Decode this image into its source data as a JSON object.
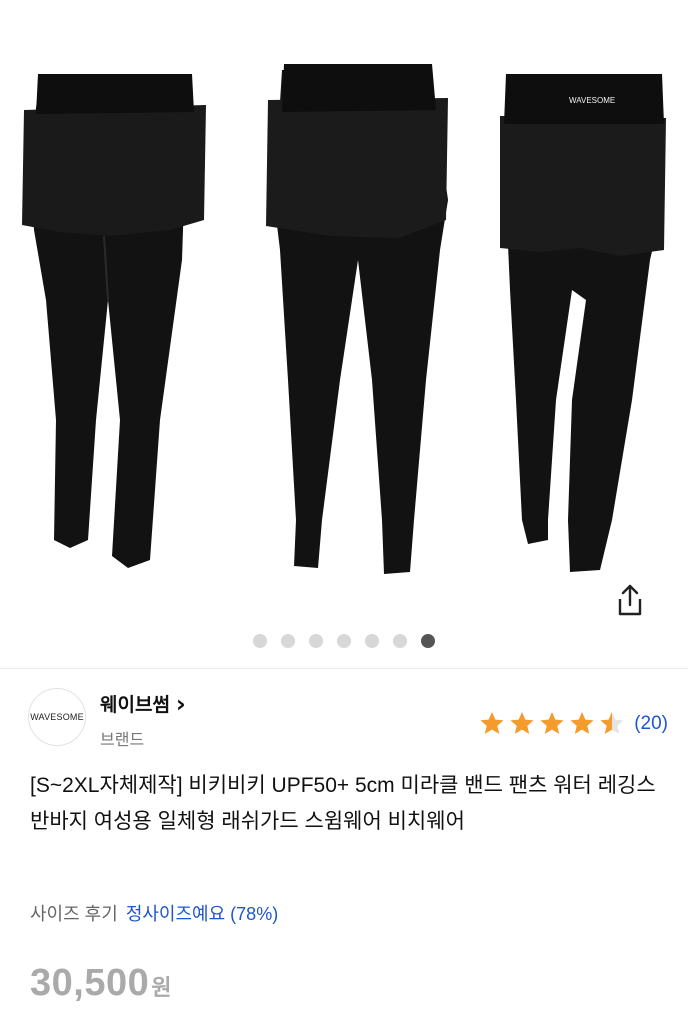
{
  "gallery": {
    "image_description": "Black leggings with attached shorts, front, side and back views",
    "waistband_logo": "WAVESOME",
    "dots_total": 7,
    "active_dot": 6,
    "share_icon": "share-icon"
  },
  "brand": {
    "logo_text": "WAVESOME",
    "name": "웨이브썸",
    "chevron": "›",
    "subtitle": "브랜드"
  },
  "rating": {
    "stars": 4.5,
    "max": 5,
    "count_text": "(20)",
    "star_color": "#f39b2c"
  },
  "product": {
    "title": "[S~2XL자체제작] 비키비키 UPF50+ 5cm 미라클 밴드 팬츠 워터 레깅스 반바지 여성용 일체형 래쉬가드 스윔웨어 비치웨어",
    "size_review_label": "사이즈 후기",
    "size_review_value": "정사이즈예요 (78%)",
    "price": "30,500",
    "price_unit": "원"
  },
  "colors": {
    "link": "#1e55d0",
    "price": "#aaaaaa",
    "garment": "#141414"
  }
}
